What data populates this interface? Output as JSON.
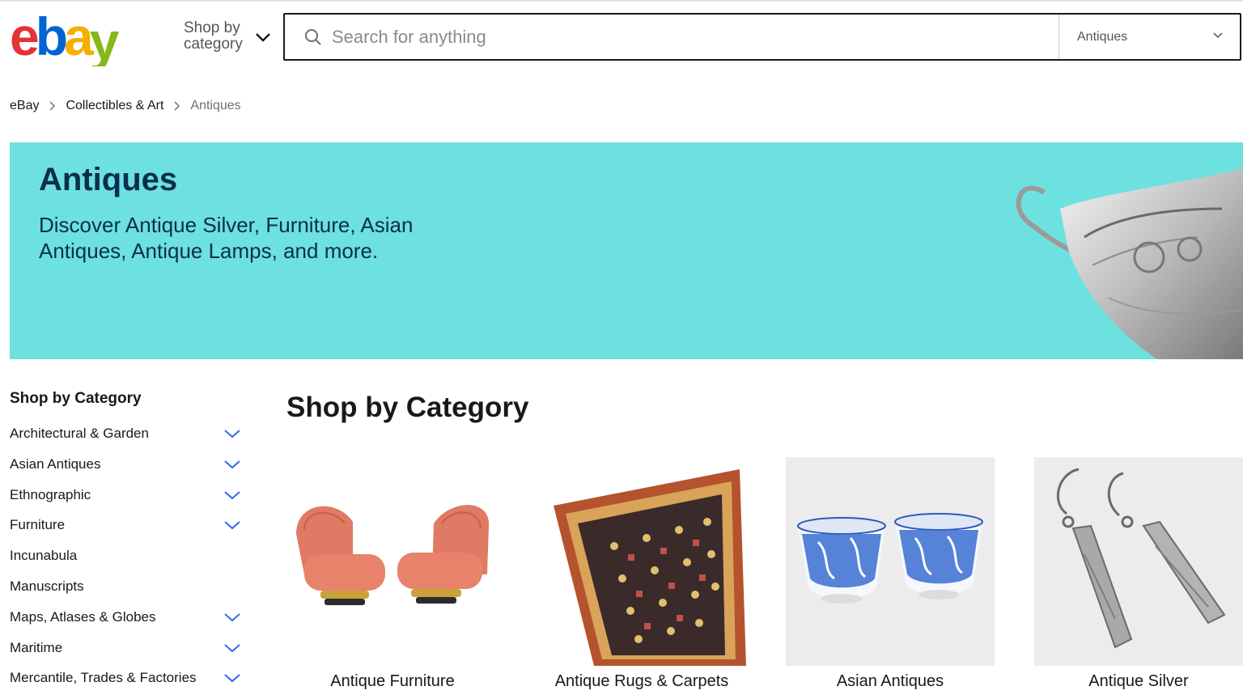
{
  "header": {
    "shop_by_category": "Shop by category",
    "search_placeholder": "Search for anything",
    "category_select": "Antiques",
    "logo_letters": [
      "e",
      "b",
      "a",
      "y"
    ],
    "logo_colors": [
      "#e53238",
      "#0064d2",
      "#f5af02",
      "#86b817"
    ]
  },
  "breadcrumb": {
    "items": [
      "eBay",
      "Collectibles & Art"
    ],
    "current": "Antiques"
  },
  "banner": {
    "title": "Antiques",
    "subtitle": "Discover Antique Silver, Furniture, Asian Antiques, Antique Lamps, and more.",
    "background": "#6de0e0"
  },
  "sidebar": {
    "title": "Shop by Category",
    "items": [
      {
        "label": "Architectural & Garden",
        "expandable": true
      },
      {
        "label": "Asian Antiques",
        "expandable": true
      },
      {
        "label": "Ethnographic",
        "expandable": true
      },
      {
        "label": "Furniture",
        "expandable": true
      },
      {
        "label": "Incunabula",
        "expandable": false
      },
      {
        "label": "Manuscripts",
        "expandable": false
      },
      {
        "label": "Maps, Atlases & Globes",
        "expandable": true
      },
      {
        "label": "Maritime",
        "expandable": true
      },
      {
        "label": "Mercantile, Trades & Factories",
        "expandable": true
      }
    ]
  },
  "main": {
    "title": "Shop by Category",
    "categories": [
      {
        "label": "Antique Furniture",
        "icon": "chairs-image"
      },
      {
        "label": "Antique Rugs & Carpets",
        "icon": "rug-image"
      },
      {
        "label": "Asian Antiques",
        "icon": "porcelain-cups-image"
      },
      {
        "label": "Antique Silver",
        "icon": "silver-earrings-image"
      }
    ]
  },
  "colors": {
    "accent_link": "#0654ba",
    "chevron": "#3665f3"
  }
}
